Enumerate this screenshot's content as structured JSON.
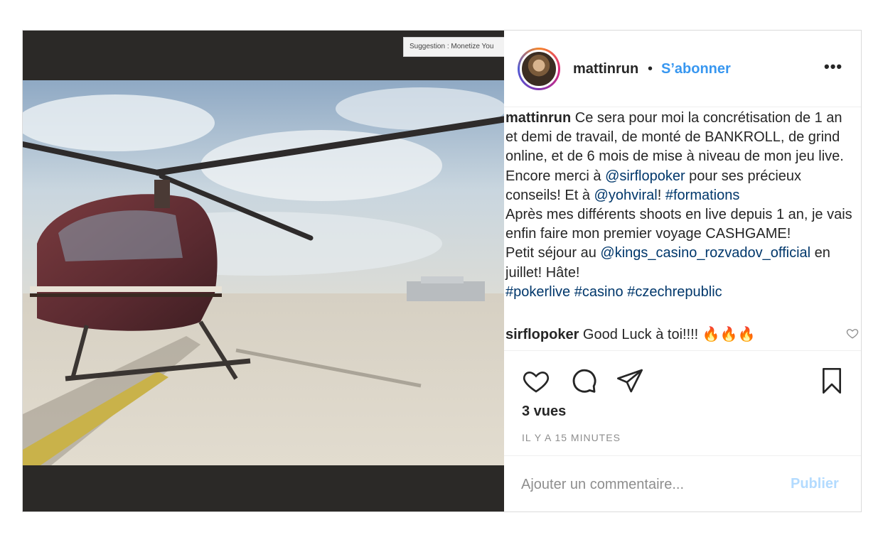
{
  "media": {
    "suggestion_text": "Suggestion : Monetize You"
  },
  "header": {
    "username": "mattinrun",
    "separator": "•",
    "follow_label": "S’abonner",
    "more_label": "•••"
  },
  "caption": {
    "username": "mattinrun",
    "line1": "Ce sera pour moi la concrétisation de 1 an et demi de travail, de monté de BANKROLL, de grind online, et de 6 mois de mise à niveau de mon jeu live.",
    "line2_pre": "Encore merci à ",
    "mention1": "@sirflopoker",
    "line2_mid": " pour ses précieux conseils! Et à ",
    "mention2": "@yohviral",
    "line2_bang": "! ",
    "tag_formations": "#formations",
    "line3": "Après mes différents shoots en live depuis 1 an, je vais enfin faire mon premier voyage CASHGAME!",
    "line4_pre": "Petit séjour au ",
    "mention3": "@kings_casino_rozvadov_official",
    "line4_post": " en juillet! Hâte!",
    "tag1": "#pokerlive",
    "tag2": "#casino",
    "tag3": "#czechrepublic"
  },
  "comment": {
    "username": "sirflopoker",
    "text": "Good Luck à toi!!!! 🔥🔥🔥"
  },
  "stats": {
    "views": "3 vues",
    "time": "IL Y A 15 MINUTES"
  },
  "add_comment": {
    "placeholder": "Ajouter un commentaire...",
    "publish_label": "Publier"
  },
  "colors": {
    "link": "#00376b",
    "follow": "#3897f0",
    "publish_disabled": "#b3dbff"
  }
}
